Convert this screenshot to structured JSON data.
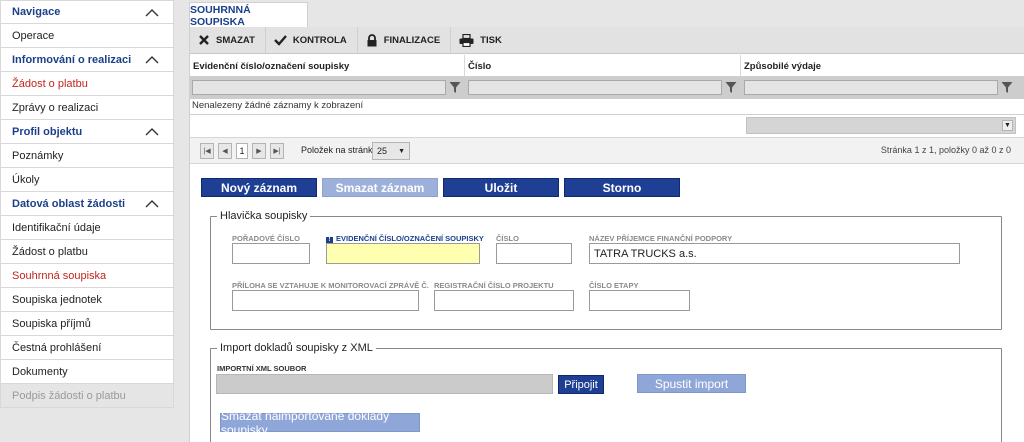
{
  "sidebar": {
    "items": [
      {
        "label": "Navigace",
        "kind": "head"
      },
      {
        "label": "Operace",
        "kind": "item"
      },
      {
        "label": "Informování o realizaci",
        "kind": "head"
      },
      {
        "label": "Žádost o platbu",
        "kind": "active"
      },
      {
        "label": "Zprávy o realizaci",
        "kind": "item"
      },
      {
        "label": "Profil objektu",
        "kind": "head"
      },
      {
        "label": "Poznámky",
        "kind": "item"
      },
      {
        "label": "Úkoly",
        "kind": "item"
      },
      {
        "label": "Datová oblast žádosti",
        "kind": "head"
      },
      {
        "label": "Identifikační údaje",
        "kind": "item"
      },
      {
        "label": "Žádost o platbu",
        "kind": "item"
      },
      {
        "label": "Souhrnná soupiska",
        "kind": "active"
      },
      {
        "label": "Soupiska jednotek",
        "kind": "item"
      },
      {
        "label": "Soupiska příjmů",
        "kind": "item"
      },
      {
        "label": "Čestná prohlášení",
        "kind": "item"
      },
      {
        "label": "Dokumenty",
        "kind": "item"
      },
      {
        "label": "Podpis žádosti o platbu",
        "kind": "disabled"
      }
    ]
  },
  "tab": {
    "label": "SOUHRNNÁ SOUPISKA"
  },
  "toolbar": {
    "delete": "SMAZAT",
    "check": "KONTROLA",
    "finalize": "FINALIZACE",
    "print": "TISK"
  },
  "grid": {
    "columns": [
      "Evidenční číslo/označení soupisky",
      "Číslo",
      "Způsobilé výdaje"
    ],
    "empty_message": "Nenalezeny žádné záznamy k zobrazení"
  },
  "pager": {
    "page": "1",
    "per_page_label": "Položek na stránku",
    "per_page": "25",
    "info": "Stránka 1 z 1, položky 0 až 0 z 0"
  },
  "actions": {
    "new": "Nový záznam",
    "delete": "Smazat záznam",
    "save": "Uložit",
    "cancel": "Storno"
  },
  "header_section": {
    "title": "Hlavička soupisky",
    "fields": {
      "order_number": {
        "label": "Pořadové číslo",
        "value": ""
      },
      "evidence_number": {
        "label": "Evidenční číslo/označení soupisky",
        "value": ""
      },
      "number": {
        "label": "Číslo",
        "value": ""
      },
      "recipient_name": {
        "label": "Název příjemce finanční podpory",
        "value": "TATRA TRUCKS a.s."
      },
      "attachment": {
        "label": "Příloha se vztahuje k monitorovací zprávě č.",
        "value": ""
      },
      "project_reg_number": {
        "label": "Registrační číslo projektu",
        "value": ""
      },
      "stage_number": {
        "label": "Číslo etapy",
        "value": ""
      }
    }
  },
  "import_section": {
    "title": "Import dokladů soupisky z XML",
    "file_label": "Importní XML soubor",
    "attach": "Připojit",
    "run_import": "Spustit import",
    "delete_imported": "Smazat naimportované doklady soupisky"
  },
  "colors": {
    "accent": "#1f3f94",
    "accent_disabled": "#9db0da",
    "active_link": "#c0241d",
    "required_field": "#ffffb0"
  }
}
